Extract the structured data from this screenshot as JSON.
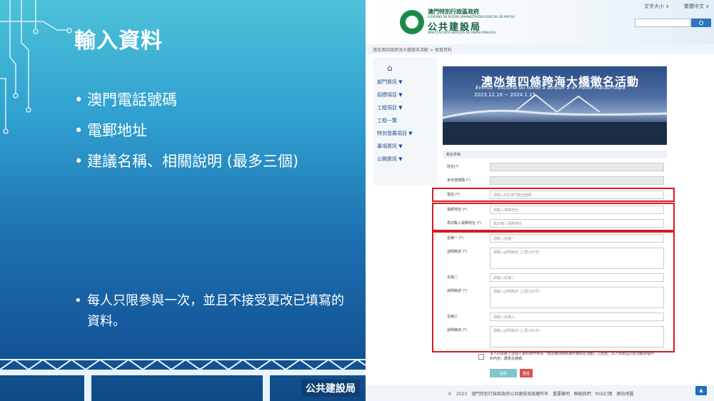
{
  "slide": {
    "title": "輸入資料",
    "bullets": [
      "澳門電話號碼",
      "電郵地址",
      "建議名稱、相關說明 (最多三個)"
    ],
    "note": "每人只限參與一次，並且不接受更改已填寫的資料。",
    "footer": "公共建設局"
  },
  "site": {
    "gov_name": "澳門特別行政區政府",
    "gov_pt": "GOVERNO DA REGIÃO ADMINISTRATIVA ESPECIAL DE MACAU",
    "dept_name": "公共建設局",
    "dept_pt": "DIRECÇÃO DOS SERVIÇOS DE OBRAS PÚBLICAS",
    "lang1": "文字大小 ∨",
    "lang2": "繁體中文 ∨",
    "breadcrumb": "澳氹第四條跨海大橋徵名活動 > 填寫資料",
    "nav": [
      "部門資訊 ▼",
      "招標項目 ▼",
      "工程項目 ▼",
      "工程一覽",
      "特別發展項目 ▼",
      "專項資訊 ▼",
      "公開資訊 ▼"
    ],
    "banner": {
      "title": "澳氹第四條跨海大橋徵名活動",
      "subtitle": "Evento - Escolha do nome a atribuir à 4ª Ponte Macau-Taipa",
      "dates": "2023.12.16 ~ 2024.1.15"
    },
    "form": {
      "header": "報名表格",
      "name_label": "姓名(*)",
      "id_label": "身份證號碼 (*)",
      "phone_label": "電話 (*)",
      "phone_ph": "請輸入8位澳門電話號碼",
      "email_label": "電郵地址 (*)",
      "email_ph": "請輸入電郵地址",
      "email2_label": "再次輸入電郵地址 (*)",
      "email2_ph": "再次輸入電郵地址",
      "name1_label": "名稱一 (*)",
      "name1_ph": "請輸入名稱一",
      "desc1_label": "說明簡述 (*)",
      "desc_ph": "請輸入說明簡述 (上限100字)",
      "name2_label": "名稱二",
      "name2_ph": "請輸入名稱二",
      "desc2_label": "說明簡述 (*)",
      "name3_label": "名稱三",
      "name3_ph": "請輸入名稱三",
      "desc3_label": "說明簡述 (*)",
      "agree": "本人同意將上述個人資料用作參與「澳氹第四條跨海大橋徵名活動」之用途。本人知悉並同意活動章程內的內容，願意及遵循。",
      "submit": "提交",
      "reset": "重設"
    },
    "footer": "© 2023 澳門特別行政區政府公共建設局版權所有  重要聲明  聯絡我們  RSS訂閱  網站地圖"
  }
}
